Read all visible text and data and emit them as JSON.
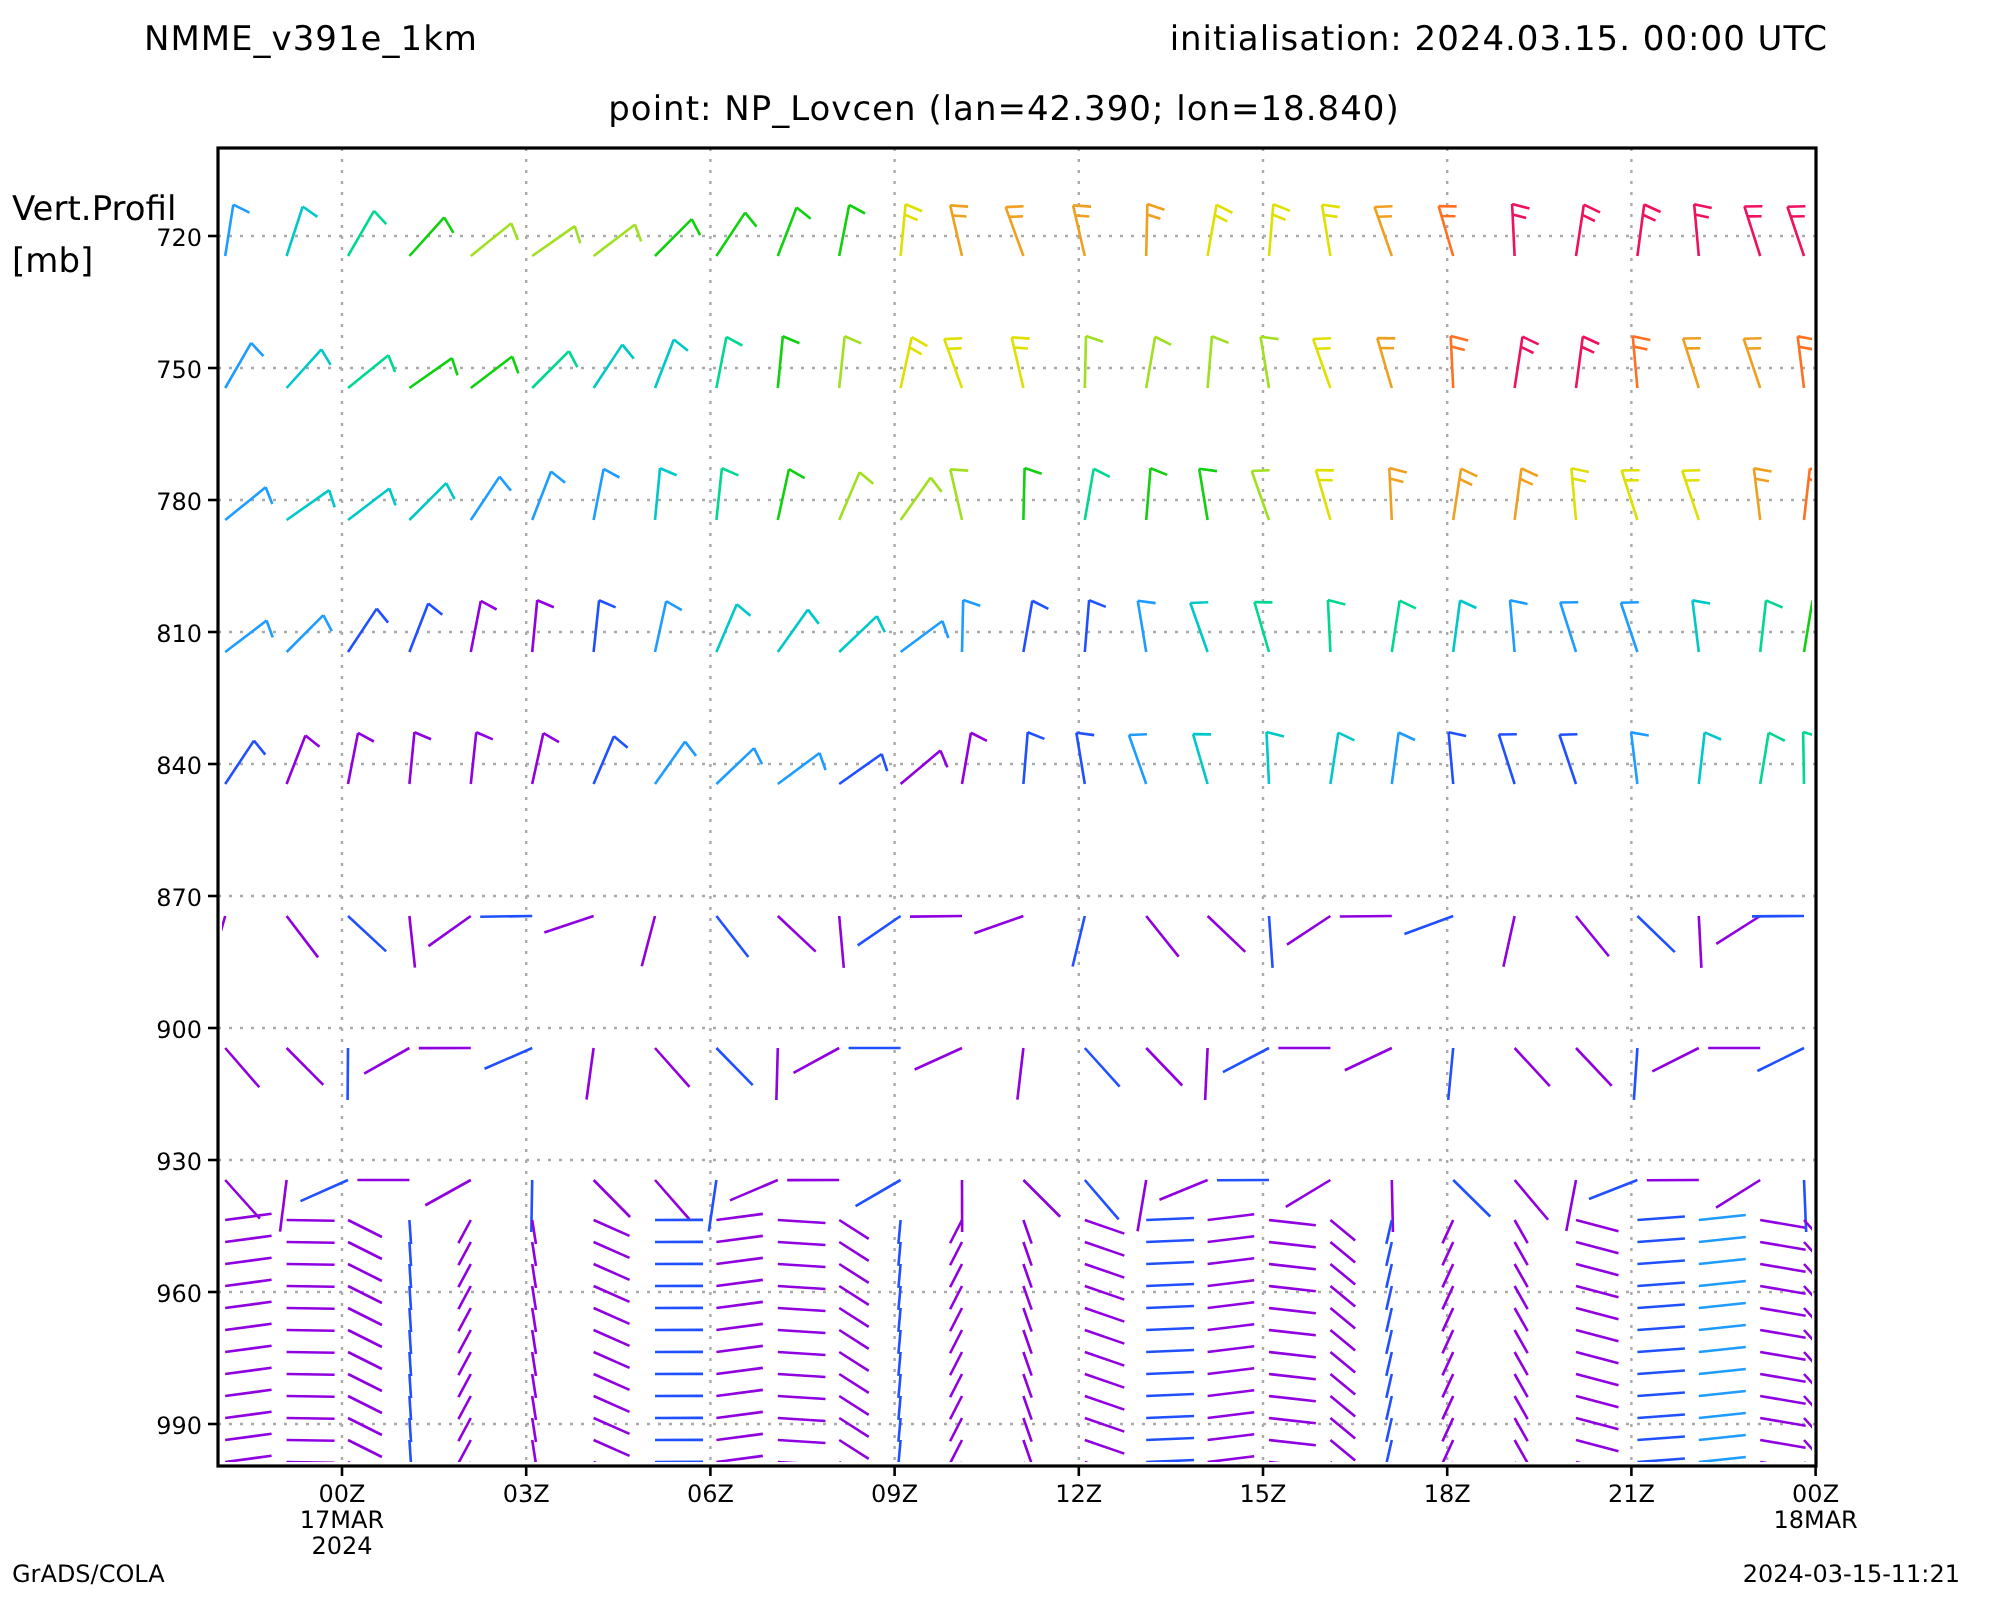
{
  "header": {
    "model": "NMME_v391e_1km",
    "initialisation": "initialisation: 2024.03.15. 00:00 UTC"
  },
  "title": "point: NP_Lovcen (lan=42.390; lon=18.840)",
  "plot": {
    "y_axis_title": [
      "Vert.Profil",
      "[mb]"
    ],
    "y_labels": [
      "720",
      "750",
      "780",
      "810",
      "840",
      "870",
      "900",
      "930",
      "960",
      "990"
    ],
    "x_labels": [
      [
        "00Z",
        "17MAR",
        "2024"
      ],
      [
        "03Z"
      ],
      [
        "06Z"
      ],
      [
        "09Z"
      ],
      [
        "12Z"
      ],
      [
        "15Z"
      ],
      [
        "18Z"
      ],
      [
        "21Z"
      ],
      [
        "00Z",
        "18MAR"
      ]
    ]
  },
  "footer": {
    "left": "GrADS/COLA",
    "right": "2024-03-15-11:21"
  }
}
